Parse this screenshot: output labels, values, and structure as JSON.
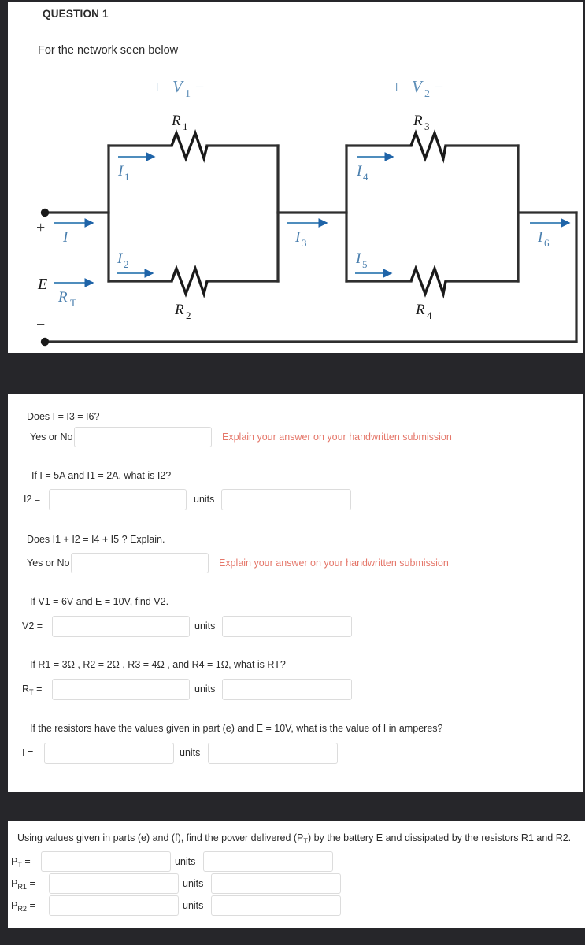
{
  "header": {
    "question_number": "QUESTION 1",
    "prompt": "For the network seen below"
  },
  "circuit": {
    "labels": {
      "v1_plus": "+",
      "v1_name": "V",
      "v1_sub": "1",
      "v1_minus": "−",
      "v2_plus": "+",
      "v2_name": "V",
      "v2_sub": "2",
      "v2_minus": "−",
      "r1": "R",
      "r1_sub": "1",
      "r2": "R",
      "r2_sub": "2",
      "r3": "R",
      "r3_sub": "3",
      "r4": "R",
      "r4_sub": "4",
      "i": "I",
      "i1": "I",
      "i1_sub": "1",
      "i2": "I",
      "i2_sub": "2",
      "i3": "I",
      "i3_sub": "3",
      "i4": "I",
      "i4_sub": "4",
      "i5": "I",
      "i5_sub": "5",
      "i6": "I",
      "i6_sub": "6",
      "e": "E",
      "rt": "R",
      "rt_sub": "T",
      "terminal_plus": "+",
      "terminal_minus": "−"
    },
    "colors": {
      "wire": "#2e2e2e",
      "accent_blue": "#6a9ec4",
      "arrow_blue": "#1f64a8",
      "label_blue": "#5f8fb8"
    }
  },
  "questions": [
    {
      "id": "a",
      "text": "Does I = I3 = I6?",
      "answer_label": "Yes or No",
      "answer_value": "",
      "note": "Explain your answer on your handwritten submission"
    },
    {
      "id": "b",
      "text": "If I = 5A and I1 = 2A, what is I2?",
      "answer_label": "I2 =",
      "answer_value": "",
      "units_label": "units",
      "units_value": ""
    },
    {
      "id": "c",
      "text": "Does I1 + I2  = I4 + I5 ? Explain.",
      "answer_label": "Yes or No",
      "answer_value": "",
      "note": "Explain your answer on your handwritten submission"
    },
    {
      "id": "d",
      "text": "If V1 = 6V and E = 10V, find V2.",
      "answer_label": "V2 =",
      "answer_value": "",
      "units_label": "units",
      "units_value": ""
    },
    {
      "id": "e",
      "text": "If R1 = 3Ω  , R2 = 2Ω  , R3 = 4Ω  , and R4 = 1Ω, what is RT?",
      "answer_label_main": "R",
      "answer_label_sub": "T",
      "answer_label_eq": " =",
      "answer_value": "",
      "units_label": "units",
      "units_value": ""
    },
    {
      "id": "f",
      "text": "If the resistors have the values given in part (e) and E = 10V, what is the value of I in amperes?",
      "answer_label": "I =",
      "answer_value": "",
      "units_label": "units",
      "units_value": ""
    }
  ],
  "bottom_section": {
    "text": "Using values given in parts (e) and (f), find the power delivered (PT) by the battery E and dissipated by the resistors R1 and R2.",
    "text_prefix": "Using values given in parts (e) and (f), find the power delivered (P",
    "text_sub": "T",
    "text_suffix": ") by the battery E and dissipated by the resistors R1 and R2.",
    "rows": [
      {
        "label_main": "P",
        "label_sub": "T",
        "label_eq": " =",
        "value": "",
        "units_label": "units",
        "units_value": ""
      },
      {
        "label_main": "P",
        "label_sub": "R1",
        "label_eq": " =",
        "value": "",
        "units_label": "units",
        "units_value": ""
      },
      {
        "label_main": "P",
        "label_sub": "R2",
        "label_eq": " =",
        "value": "",
        "units_label": "units",
        "units_value": ""
      }
    ]
  }
}
